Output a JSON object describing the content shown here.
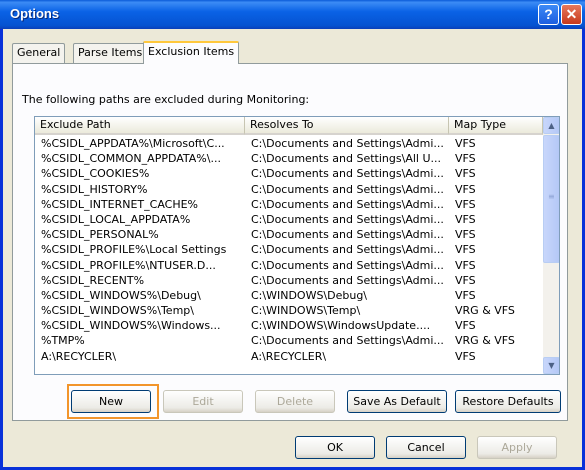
{
  "window": {
    "title": "Options"
  },
  "titlebar": {
    "help_label": "?",
    "close_label": "✕"
  },
  "tabs": [
    {
      "label": "General",
      "active": false
    },
    {
      "label": "Parse Items",
      "active": false
    },
    {
      "label": "Exclusion Items",
      "active": true
    }
  ],
  "panel": {
    "description": "The following paths are excluded during Monitoring:"
  },
  "listview": {
    "columns": [
      "Exclude Path",
      "Resolves To",
      "Map Type"
    ],
    "rows": [
      [
        "%CSIDL_APPDATA%\\Microsoft\\C...",
        "C:\\Documents and Settings\\Admi...",
        "VFS"
      ],
      [
        "%CSIDL_COMMON_APPDATA%\\...",
        "C:\\Documents and Settings\\All U...",
        "VFS"
      ],
      [
        "%CSIDL_COOKIES%",
        "C:\\Documents and Settings\\Admi...",
        "VFS"
      ],
      [
        "%CSIDL_HISTORY%",
        "C:\\Documents and Settings\\Admi...",
        "VFS"
      ],
      [
        "%CSIDL_INTERNET_CACHE%",
        "C:\\Documents and Settings\\Admi...",
        "VFS"
      ],
      [
        "%CSIDL_LOCAL_APPDATA%",
        "C:\\Documents and Settings\\Admi...",
        "VFS"
      ],
      [
        "%CSIDL_PERSONAL%",
        "C:\\Documents and Settings\\Admi...",
        "VFS"
      ],
      [
        "%CSIDL_PROFILE%\\Local Settings",
        "C:\\Documents and Settings\\Admi...",
        "VFS"
      ],
      [
        "%CSIDL_PROFILE%\\NTUSER.D...",
        "C:\\Documents and Settings\\Admi...",
        "VFS"
      ],
      [
        "%CSIDL_RECENT%",
        "C:\\Documents and Settings\\Admi...",
        "VFS"
      ],
      [
        "%CSIDL_WINDOWS%\\Debug\\",
        "C:\\WINDOWS\\Debug\\",
        "VFS"
      ],
      [
        "%CSIDL_WINDOWS%\\Temp\\",
        "C:\\WINDOWS\\Temp\\",
        "VRG & VFS"
      ],
      [
        "%CSIDL_WINDOWS%\\Windows...",
        "C:\\WINDOWS\\WindowsUpdate....",
        "VFS"
      ],
      [
        "%TMP%",
        "C:\\Documents and Settings\\Admi...",
        "VRG & VFS"
      ],
      [
        "A:\\RECYCLER\\",
        "A:\\RECYCLER\\",
        "VFS"
      ]
    ]
  },
  "scrollbar": {
    "up_glyph": "▲",
    "down_glyph": "▼",
    "grip_glyph": "≡"
  },
  "buttons": {
    "new": "New",
    "edit": "Edit",
    "delete": "Delete",
    "save_default": "Save As Default",
    "restore_defaults": "Restore Defaults",
    "ok": "OK",
    "cancel": "Cancel",
    "apply": "Apply"
  },
  "colors": {
    "highlight": "#f2952b",
    "titlebar": "#0a62e6"
  }
}
